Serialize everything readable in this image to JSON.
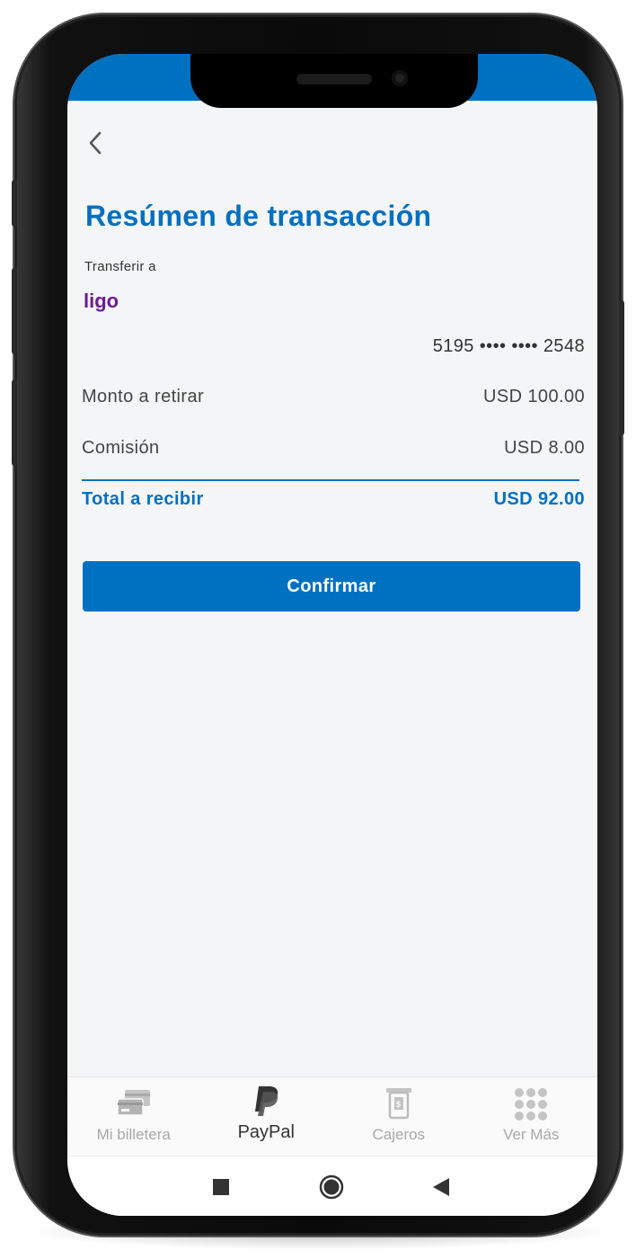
{
  "header": {
    "title": "Resúmen de transacción"
  },
  "recipient": {
    "label": "Transferir a",
    "logo_text": "ligo",
    "card_number": "5195 •••• •••• 2548"
  },
  "summary": {
    "withdraw_label": "Monto a retirar",
    "withdraw_value": "USD 100.00",
    "fee_label": "Comisión",
    "fee_value": "USD 8.00",
    "total_label": "Total a recibir",
    "total_value": "USD 92.00"
  },
  "actions": {
    "confirm_label": "Confirmar"
  },
  "tabbar": {
    "items": [
      {
        "label": "Mi billetera",
        "icon": "wallet-cards-icon",
        "active": false
      },
      {
        "label": "PayPal",
        "icon": "paypal-icon",
        "active": true
      },
      {
        "label": "Cajeros",
        "icon": "atm-icon",
        "active": false
      },
      {
        "label": "Ver Más",
        "icon": "grid-dots-icon",
        "active": false
      }
    ]
  },
  "colors": {
    "brand": "#0070c1",
    "ligo": "#6b1d8f",
    "background": "#f4f5f6"
  }
}
